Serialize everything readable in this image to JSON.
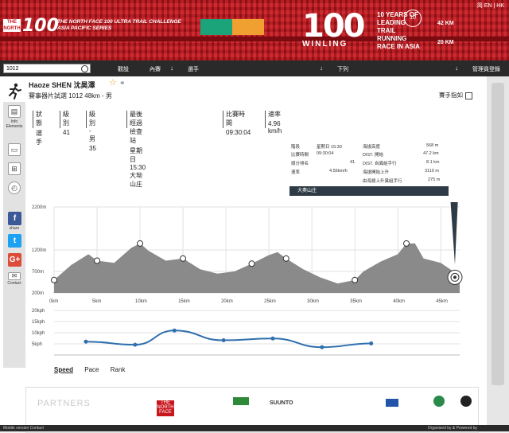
{
  "banner": {
    "logo_text": "THE NORTH FACE",
    "logo_100": "100",
    "title_line1": "THE NORTH FACE 100  ULTRA TRAIL CHALLENGE",
    "title_line2": "ASIA PACIFIC SERIES",
    "big_100": "100",
    "event_name": "WINLING",
    "ten_years": "10 YEARS OF LEADING TRAIL RUNNING RACE IN ASIA",
    "badge": "10",
    "dist1": "42 KM",
    "dist2": "20 KM",
    "lang": "简  EN | HK",
    "colors": {
      "red": "#c8161d",
      "green": "#1ba37a",
      "orange": "#f0a030"
    }
  },
  "topbar": {
    "search_value": "1012",
    "nav": [
      "觀設",
      "內賽",
      "選手",
      "下列",
      "管理員登錄"
    ]
  },
  "athlete": {
    "name": "Haoze SHEN  沈昊澤",
    "sub": "賽事器片試選 1012  48km - 男",
    "manual": "賽手指如"
  },
  "stats": [
    {
      "label": "狀態",
      "value": "選手"
    },
    {
      "label": "級別",
      "value": "41"
    },
    {
      "label": "級別 - 男",
      "value": "35"
    },
    {
      "label": "最後經過檢查站",
      "value": "星期日  15:30   大坳山庄"
    },
    {
      "label": "比賽時間",
      "value": "09:30:04"
    },
    {
      "label": "速率",
      "value": "4.96 km/h"
    }
  ],
  "sidebar": {
    "info_label": "Info Elements",
    "share_label": "share",
    "contact_label": "Contact"
  },
  "info_box": {
    "rows": [
      [
        "階段",
        "星期日 15:30",
        "海拔高度",
        "568 m"
      ],
      [
        "比賽時間",
        "09:30:04",
        "DIST. 開始",
        "47.2 km"
      ],
      [
        "總分排名",
        "41",
        "DIST. 自異組手行",
        "8.1 km"
      ],
      [
        "速率",
        "4.55km/h",
        "海拔開始上升",
        "3110 m"
      ],
      [
        "",
        "",
        "由海拔上升異組手行",
        "275 m"
      ]
    ],
    "pin_label": "大奧山庄"
  },
  "chart_data": [
    {
      "type": "area",
      "title": "",
      "xlabel": "",
      "ylabel": "",
      "ylim": [
        200,
        2200
      ],
      "y_ticks": [
        "2200m",
        "1200m",
        "700m",
        "200m"
      ],
      "x_ticks": [
        "0km",
        "5km",
        "10km",
        "15km",
        "20km",
        "25km",
        "30km",
        "35km",
        "40km",
        "45km"
      ],
      "x": [
        0,
        2,
        4,
        5,
        7,
        9,
        10,
        11,
        13,
        15,
        17,
        19,
        21,
        23,
        25,
        26,
        27,
        29,
        31,
        33,
        35,
        36,
        38,
        40,
        41,
        42,
        43,
        45,
        47.2
      ],
      "values": [
        500,
        850,
        1100,
        950,
        900,
        1250,
        1350,
        1180,
        950,
        1000,
        750,
        650,
        700,
        880,
        1080,
        1150,
        1000,
        750,
        560,
        420,
        500,
        700,
        930,
        1100,
        1350,
        1350,
        1000,
        900,
        600
      ]
    },
    {
      "type": "line",
      "title": "",
      "xlabel": "",
      "ylabel": "",
      "ylim": [
        0,
        20
      ],
      "y_ticks": [
        "20kph",
        "15kph",
        "10kph",
        "5kph"
      ],
      "x": [
        0,
        5,
        9,
        14,
        19,
        24,
        29,
        33
      ],
      "values": [
        6,
        4.6,
        11,
        6.6,
        7.4,
        3.5,
        5.2,
        0
      ],
      "markers": [
        6,
        4.6,
        11,
        6.6,
        7.4,
        3.5,
        5.2
      ]
    }
  ],
  "tabs": [
    "Speed",
    "Pace",
    "Rank"
  ],
  "partners": {
    "title": "PARTNERS",
    "logos": [
      "THE NORTH FACE",
      "",
      "SUUNTO",
      "",
      ""
    ]
  },
  "footer": {
    "left": "Mobile version  Contact",
    "right": "Organized by  &  Powered by"
  }
}
